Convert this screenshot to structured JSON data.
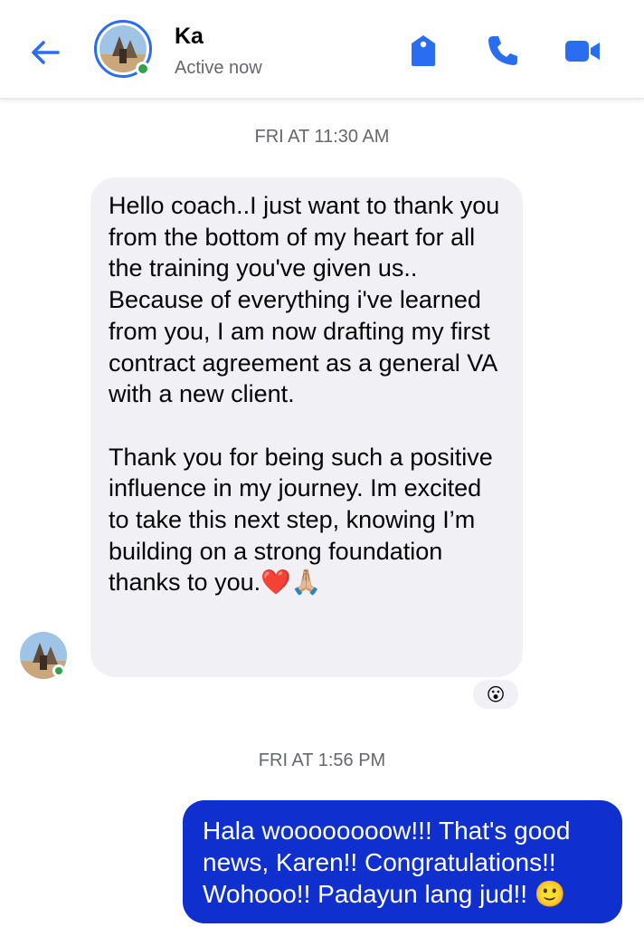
{
  "header": {
    "contact_name": "Ka",
    "status": "Active now",
    "icons": [
      "back-arrow-icon",
      "tag-icon",
      "phone-icon",
      "video-camera-icon"
    ],
    "accent_color": "#2b6df0",
    "online_color": "#31a24c"
  },
  "thread": {
    "messages": [
      {
        "timestamp": "FRI AT 11:30 AM",
        "direction": "incoming",
        "text": "Hello coach..I just want to thank you from the bottom of my heart for all the training you've given us..\nBecause of everything i've learned from you, I am now drafting my first contract agreement as a general VA with a new client.\n\nThank you for being such a positive influence in my journey. Im excited to take this next step, knowing I’m building on a strong foundation thanks to you.❤️🙏🏼",
        "reaction": "😮"
      },
      {
        "timestamp": "FRI AT 1:56 PM",
        "direction": "outgoing",
        "text": "Hala woooooooow!!! That's good news, Karen!! Congratulations!! Wohooo!! Padayun lang jud!! 🙂",
        "bubble_color": "#0f2fcf"
      }
    ]
  }
}
